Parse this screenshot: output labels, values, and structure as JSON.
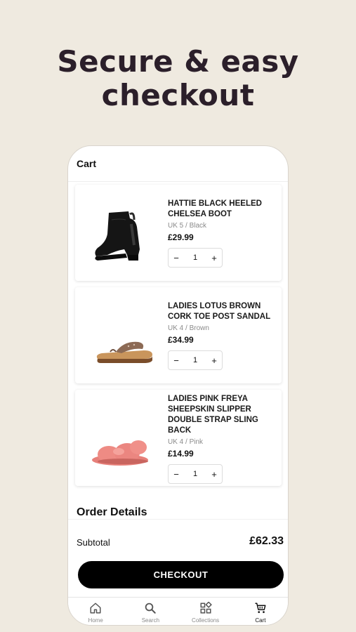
{
  "promo": {
    "line1": "Secure & easy",
    "line2": "checkout"
  },
  "cart": {
    "title": "Cart",
    "items": [
      {
        "name": "HATTIE BLACK HEELED CHELSEA BOOT",
        "variant": "UK 5 / Black",
        "price": "£29.99",
        "qty": "1",
        "minus": "−",
        "plus": "+"
      },
      {
        "name": "LADIES LOTUS BROWN CORK TOE POST SANDAL",
        "variant": "UK 4 / Brown",
        "price": "£34.99",
        "qty": "1",
        "minus": "−",
        "plus": "+"
      },
      {
        "name": "LADIES PINK FREYA SHEEPSKIN SLIPPER DOUBLE STRAP SLING BACK",
        "variant": "UK 4 / Pink",
        "price": "£14.99",
        "qty": "1",
        "minus": "−",
        "plus": "+"
      }
    ]
  },
  "order": {
    "title": "Order Details",
    "subtotal_label": "Subtotal",
    "subtotal_value": "£62.33"
  },
  "checkout_label": "CHECKOUT",
  "tabs": [
    {
      "label": "Home",
      "icon": "home-icon"
    },
    {
      "label": "Search",
      "icon": "search-icon"
    },
    {
      "label": "Collections",
      "icon": "collections-icon"
    },
    {
      "label": "Cart",
      "icon": "cart-icon"
    }
  ],
  "colors": {
    "background": "#efeae0",
    "headline": "#2b1f2a",
    "button": "#000000"
  }
}
